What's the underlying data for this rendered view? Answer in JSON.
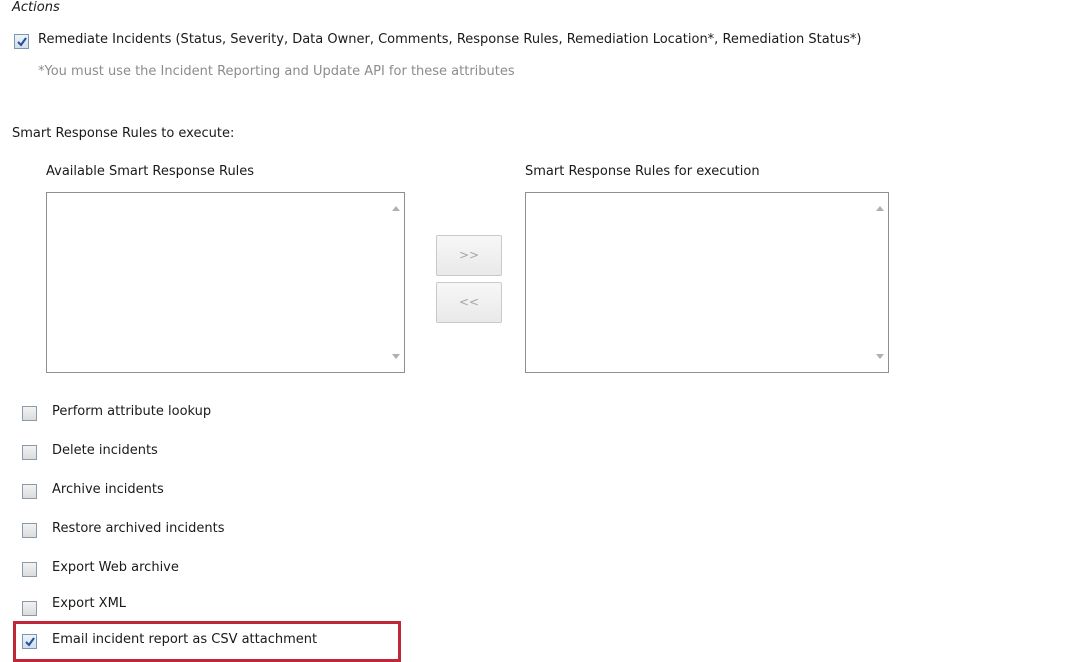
{
  "actions": {
    "title": "Actions",
    "remediate": {
      "label": "Remediate Incidents (Status, Severity, Data Owner, Comments, Response Rules, Remediation Location*, Remediation Status*)",
      "checked": true
    },
    "note": "*You must use the Incident Reporting and Update API for these attributes"
  },
  "smart_response": {
    "heading": "Smart Response Rules to execute:",
    "available_label": "Available Smart Response Rules",
    "execution_label": "Smart Response Rules for execution",
    "add_button": ">>",
    "remove_button": "<<"
  },
  "options": [
    {
      "label": "Perform attribute lookup",
      "checked": false
    },
    {
      "label": "Delete incidents",
      "checked": false
    },
    {
      "label": "Archive incidents",
      "checked": false
    },
    {
      "label": "Restore archived incidents",
      "checked": false
    },
    {
      "label": "Export Web archive",
      "checked": false
    },
    {
      "label": "Export XML",
      "checked": false
    },
    {
      "label": "Email incident report as CSV attachment",
      "checked": true
    }
  ],
  "colors": {
    "highlight": "#c0283a",
    "checkmark": "#1d4f9c"
  }
}
